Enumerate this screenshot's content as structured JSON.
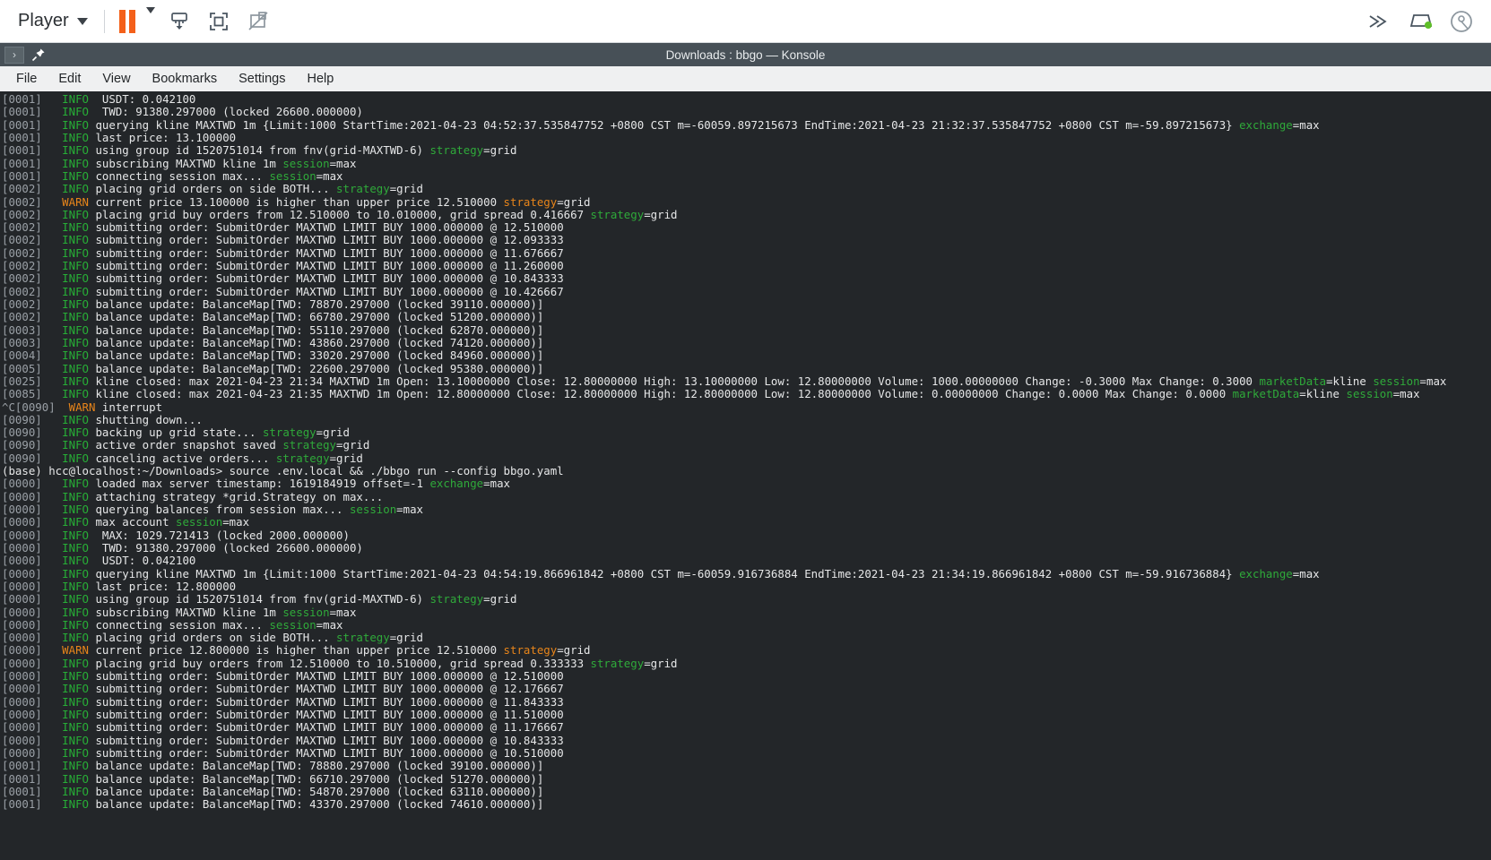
{
  "player_bar": {
    "menu_label": "Player",
    "icons": {
      "pause": "pause-icon",
      "pause_dropdown": "chevron-down-icon",
      "snapshot": "save-frame-icon",
      "fullscreen": "fullscreen-icon",
      "no_overlay": "disable-overlay-icon",
      "overflow": "double-chevron-right-icon",
      "display": "display-status-icon",
      "record": "record-icon"
    }
  },
  "window": {
    "title": "Downloads : bbgo — Konsole",
    "tab_chevron": "›",
    "pin": "pin-icon",
    "menus": [
      "File",
      "Edit",
      "View",
      "Bookmarks",
      "Settings",
      "Help"
    ]
  },
  "terminal": {
    "prompt": "(base) hcc@localhost:~/Downloads> source .env.local && ./bbgo run --config bbgo.yaml",
    "lines": [
      {
        "id": "[0001]",
        "lvl": "INFO",
        "msg": " USDT: 0.042100"
      },
      {
        "id": "[0001]",
        "lvl": "INFO",
        "msg": " TWD: 91380.297000 (locked 26600.000000)"
      },
      {
        "id": "[0001]",
        "lvl": "INFO",
        "msg": "querying kline MAXTWD 1m {Limit:1000 StartTime:2021-04-23 04:52:37.535847752 +0800 CST m=-60059.897215673 EndTime:2021-04-23 21:32:37.535847752 +0800 CST m=-59.897215673} ",
        "kv": [
          [
            "exchange",
            "max"
          ]
        ]
      },
      {
        "id": "[0001]",
        "lvl": "INFO",
        "msg": "last price: 13.100000"
      },
      {
        "id": "[0001]",
        "lvl": "INFO",
        "msg": "using group id 1520751014 from fnv(grid-MAXTWD-6) ",
        "kv": [
          [
            "strategy",
            "grid"
          ]
        ]
      },
      {
        "id": "[0001]",
        "lvl": "INFO",
        "msg": "subscribing MAXTWD kline 1m ",
        "kv": [
          [
            "session",
            "max"
          ]
        ]
      },
      {
        "id": "[0001]",
        "lvl": "INFO",
        "msg": "connecting session max... ",
        "kv": [
          [
            "session",
            "max"
          ]
        ]
      },
      {
        "id": "[0002]",
        "lvl": "INFO",
        "msg": "placing grid orders on side BOTH... ",
        "kv": [
          [
            "strategy",
            "grid"
          ]
        ]
      },
      {
        "id": "[0002]",
        "lvl": "WARN",
        "msg": "current price 13.100000 is higher than upper price 12.510000 ",
        "kv": [
          [
            "strategy",
            "grid"
          ]
        ]
      },
      {
        "id": "[0002]",
        "lvl": "INFO",
        "msg": "placing grid buy orders from 12.510000 to 10.010000, grid spread 0.416667 ",
        "kv": [
          [
            "strategy",
            "grid"
          ]
        ]
      },
      {
        "id": "[0002]",
        "lvl": "INFO",
        "msg": "submitting order: SubmitOrder MAXTWD LIMIT BUY 1000.000000 @ 12.510000"
      },
      {
        "id": "[0002]",
        "lvl": "INFO",
        "msg": "submitting order: SubmitOrder MAXTWD LIMIT BUY 1000.000000 @ 12.093333"
      },
      {
        "id": "[0002]",
        "lvl": "INFO",
        "msg": "submitting order: SubmitOrder MAXTWD LIMIT BUY 1000.000000 @ 11.676667"
      },
      {
        "id": "[0002]",
        "lvl": "INFO",
        "msg": "submitting order: SubmitOrder MAXTWD LIMIT BUY 1000.000000 @ 11.260000"
      },
      {
        "id": "[0002]",
        "lvl": "INFO",
        "msg": "submitting order: SubmitOrder MAXTWD LIMIT BUY 1000.000000 @ 10.843333"
      },
      {
        "id": "[0002]",
        "lvl": "INFO",
        "msg": "submitting order: SubmitOrder MAXTWD LIMIT BUY 1000.000000 @ 10.426667"
      },
      {
        "id": "[0002]",
        "lvl": "INFO",
        "msg": "balance update: BalanceMap[TWD: 78870.297000 (locked 39110.000000)]"
      },
      {
        "id": "[0002]",
        "lvl": "INFO",
        "msg": "balance update: BalanceMap[TWD: 66780.297000 (locked 51200.000000)]"
      },
      {
        "id": "[0003]",
        "lvl": "INFO",
        "msg": "balance update: BalanceMap[TWD: 55110.297000 (locked 62870.000000)]"
      },
      {
        "id": "[0003]",
        "lvl": "INFO",
        "msg": "balance update: BalanceMap[TWD: 43860.297000 (locked 74120.000000)]"
      },
      {
        "id": "[0004]",
        "lvl": "INFO",
        "msg": "balance update: BalanceMap[TWD: 33020.297000 (locked 84960.000000)]"
      },
      {
        "id": "[0005]",
        "lvl": "INFO",
        "msg": "balance update: BalanceMap[TWD: 22600.297000 (locked 95380.000000)]"
      },
      {
        "id": "[0025]",
        "lvl": "INFO",
        "msg": "kline closed: max 2021-04-23 21:34 MAXTWD 1m Open: 13.10000000 Close: 12.80000000 High: 13.10000000 Low: 12.80000000 Volume: 1000.00000000 Change: -0.3000 Max Change: 0.3000 ",
        "kv": [
          [
            "marketData",
            "kline"
          ],
          [
            "session",
            "max"
          ]
        ]
      },
      {
        "id": "[0085]",
        "lvl": "INFO",
        "msg": "kline closed: max 2021-04-23 21:35 MAXTWD 1m Open: 12.80000000 Close: 12.80000000 High: 12.80000000 Low: 12.80000000 Volume: 0.00000000 Change: 0.0000 Max Change: 0.0000 ",
        "kv": [
          [
            "marketData",
            "kline"
          ],
          [
            "session",
            "max"
          ]
        ]
      },
      {
        "id": "^C[0090]",
        "lvl": "WARN",
        "msg": "interrupt"
      },
      {
        "id": "[0090]",
        "lvl": "INFO",
        "msg": "shutting down..."
      },
      {
        "id": "[0090]",
        "lvl": "INFO",
        "msg": "backing up grid state... ",
        "kv": [
          [
            "strategy",
            "grid"
          ]
        ]
      },
      {
        "id": "[0090]",
        "lvl": "INFO",
        "msg": "active order snapshot saved ",
        "kv": [
          [
            "strategy",
            "grid"
          ]
        ]
      },
      {
        "id": "[0090]",
        "lvl": "INFO",
        "msg": "canceling active orders... ",
        "kv": [
          [
            "strategy",
            "grid"
          ]
        ]
      },
      {
        "prompt": true
      },
      {
        "id": "[0000]",
        "lvl": "INFO",
        "msg": "loaded max server timestamp: 1619184919 offset=-1 ",
        "kv": [
          [
            "exchange",
            "max"
          ]
        ]
      },
      {
        "id": "[0000]",
        "lvl": "INFO",
        "msg": "attaching strategy *grid.Strategy on max..."
      },
      {
        "id": "[0000]",
        "lvl": "INFO",
        "msg": "querying balances from session max... ",
        "kv": [
          [
            "session",
            "max"
          ]
        ]
      },
      {
        "id": "[0000]",
        "lvl": "INFO",
        "msg": "max account ",
        "kv": [
          [
            "session",
            "max"
          ]
        ]
      },
      {
        "id": "[0000]",
        "lvl": "INFO",
        "msg": " MAX: 1029.721413 (locked 2000.000000)"
      },
      {
        "id": "[0000]",
        "lvl": "INFO",
        "msg": " TWD: 91380.297000 (locked 26600.000000)"
      },
      {
        "id": "[0000]",
        "lvl": "INFO",
        "msg": " USDT: 0.042100"
      },
      {
        "id": "[0000]",
        "lvl": "INFO",
        "msg": "querying kline MAXTWD 1m {Limit:1000 StartTime:2021-04-23 04:54:19.866961842 +0800 CST m=-60059.916736884 EndTime:2021-04-23 21:34:19.866961842 +0800 CST m=-59.916736884} ",
        "kv": [
          [
            "exchange",
            "max"
          ]
        ]
      },
      {
        "id": "[0000]",
        "lvl": "INFO",
        "msg": "last price: 12.800000"
      },
      {
        "id": "[0000]",
        "lvl": "INFO",
        "msg": "using group id 1520751014 from fnv(grid-MAXTWD-6) ",
        "kv": [
          [
            "strategy",
            "grid"
          ]
        ]
      },
      {
        "id": "[0000]",
        "lvl": "INFO",
        "msg": "subscribing MAXTWD kline 1m ",
        "kv": [
          [
            "session",
            "max"
          ]
        ]
      },
      {
        "id": "[0000]",
        "lvl": "INFO",
        "msg": "connecting session max... ",
        "kv": [
          [
            "session",
            "max"
          ]
        ]
      },
      {
        "id": "[0000]",
        "lvl": "INFO",
        "msg": "placing grid orders on side BOTH... ",
        "kv": [
          [
            "strategy",
            "grid"
          ]
        ]
      },
      {
        "id": "[0000]",
        "lvl": "WARN",
        "msg": "current price 12.800000 is higher than upper price 12.510000 ",
        "kv": [
          [
            "strategy",
            "grid"
          ]
        ]
      },
      {
        "id": "[0000]",
        "lvl": "INFO",
        "msg": "placing grid buy orders from 12.510000 to 10.510000, grid spread 0.333333 ",
        "kv": [
          [
            "strategy",
            "grid"
          ]
        ]
      },
      {
        "id": "[0000]",
        "lvl": "INFO",
        "msg": "submitting order: SubmitOrder MAXTWD LIMIT BUY 1000.000000 @ 12.510000"
      },
      {
        "id": "[0000]",
        "lvl": "INFO",
        "msg": "submitting order: SubmitOrder MAXTWD LIMIT BUY 1000.000000 @ 12.176667"
      },
      {
        "id": "[0000]",
        "lvl": "INFO",
        "msg": "submitting order: SubmitOrder MAXTWD LIMIT BUY 1000.000000 @ 11.843333"
      },
      {
        "id": "[0000]",
        "lvl": "INFO",
        "msg": "submitting order: SubmitOrder MAXTWD LIMIT BUY 1000.000000 @ 11.510000"
      },
      {
        "id": "[0000]",
        "lvl": "INFO",
        "msg": "submitting order: SubmitOrder MAXTWD LIMIT BUY 1000.000000 @ 11.176667"
      },
      {
        "id": "[0000]",
        "lvl": "INFO",
        "msg": "submitting order: SubmitOrder MAXTWD LIMIT BUY 1000.000000 @ 10.843333"
      },
      {
        "id": "[0000]",
        "lvl": "INFO",
        "msg": "submitting order: SubmitOrder MAXTWD LIMIT BUY 1000.000000 @ 10.510000"
      },
      {
        "id": "[0001]",
        "lvl": "INFO",
        "msg": "balance update: BalanceMap[TWD: 78880.297000 (locked 39100.000000)]"
      },
      {
        "id": "[0001]",
        "lvl": "INFO",
        "msg": "balance update: BalanceMap[TWD: 66710.297000 (locked 51270.000000)]"
      },
      {
        "id": "[0001]",
        "lvl": "INFO",
        "msg": "balance update: BalanceMap[TWD: 54870.297000 (locked 63110.000000)]"
      },
      {
        "id": "[0001]",
        "lvl": "INFO",
        "msg": "balance update: BalanceMap[TWD: 43370.297000 (locked 74610.000000)]"
      }
    ]
  },
  "colors": {
    "accent_orange": "#f4601a",
    "terminal_bg": "#232629",
    "info_green": "#27ae36",
    "warn_orange": "#e8851a",
    "titlebar": "#475057"
  }
}
